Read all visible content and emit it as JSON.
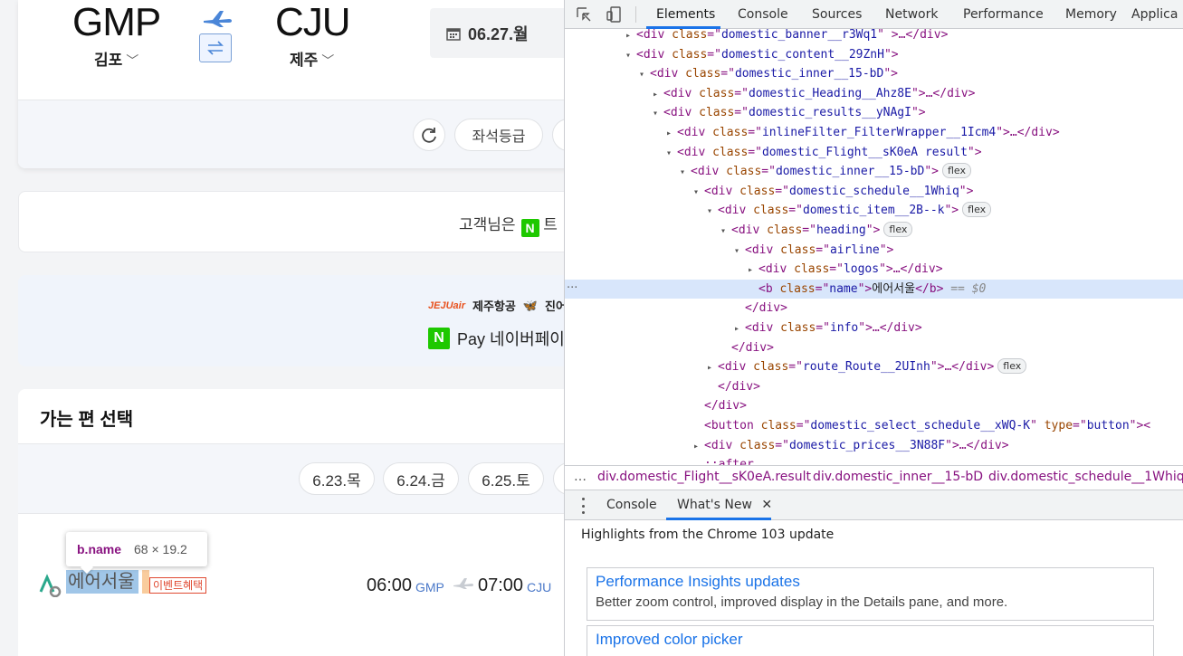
{
  "search": {
    "origin_code": "GMP",
    "origin_name": "김포",
    "dest_code": "CJU",
    "dest_name": "제주",
    "date": "06.27.월",
    "seat_filter": "좌석등급"
  },
  "notice": {
    "text": "고객님은",
    "badge": "N",
    "tail": "트"
  },
  "promo": {
    "airline_logo": "JEJUair",
    "airline_name": "제주항공",
    "airline2": "진어",
    "pay_badge": "N",
    "pay_text": "Pay 네이버페이포"
  },
  "results": {
    "title": "가는 편 선택",
    "dates": [
      "6.23.목",
      "6.24.금",
      "6.25.토"
    ]
  },
  "tooltip": {
    "selector": "b.name",
    "size": "68 × 19.2"
  },
  "flight": {
    "airline": "에어서울",
    "badge": "이벤트혜택",
    "dep_time": "06:00",
    "dep_code": "GMP",
    "arr_time": "07:00",
    "arr_code": "CJU"
  },
  "devtools": {
    "tabs": [
      "Elements",
      "Console",
      "Sources",
      "Network",
      "Performance",
      "Memory",
      "Applica"
    ],
    "dom": [
      {
        "indent": 0,
        "tri": "▸",
        "cls": "domestic_banner__r3Wq1",
        "tail": " >…</div>"
      },
      {
        "indent": 0,
        "tri": "▾",
        "cls": "domestic_content__29ZnH",
        "tail": ">"
      },
      {
        "indent": 1,
        "tri": "▾",
        "cls": "domestic_inner__15-bD",
        "tail": ">"
      },
      {
        "indent": 2,
        "tri": "▸",
        "cls": "domestic_Heading__Ahz8E",
        "tail": ">…</div>"
      },
      {
        "indent": 2,
        "tri": "▾",
        "cls": "domestic_results__yNAgI",
        "tail": ">"
      },
      {
        "indent": 3,
        "tri": "▸",
        "cls": "inlineFilter_FilterWrapper__1Icm4",
        "tail": ">…</div>"
      },
      {
        "indent": 3,
        "tri": "▾",
        "cls": "domestic_Flight__sK0eA result",
        "tail": ">"
      },
      {
        "indent": 4,
        "tri": "▾",
        "cls": "domestic_inner__15-bD",
        "tail": ">",
        "flex": "flex"
      },
      {
        "indent": 5,
        "tri": "▾",
        "cls": "domestic_schedule__1Whiq",
        "tail": ">"
      },
      {
        "indent": 6,
        "tri": "▾",
        "cls": "domestic_item__2B--k",
        "tail": ">",
        "flex": "flex"
      },
      {
        "indent": 7,
        "tri": "▾",
        "cls": "heading",
        "tail": ">",
        "flex": "flex"
      },
      {
        "indent": 8,
        "tri": "▾",
        "cls": "airline",
        "tail": ">"
      },
      {
        "indent": 9,
        "tri": "▸",
        "cls": "logos",
        "tail": ">…</div>"
      }
    ],
    "selected_line": {
      "tag": "b",
      "cls": "name",
      "text": "에어서울",
      "eq": "== $0"
    },
    "dom_after": [
      {
        "indent": 8,
        "raw": "</div>"
      },
      {
        "indent": 8,
        "tri": "▸",
        "cls": "info",
        "tail": ">…</div>"
      },
      {
        "indent": 7,
        "raw": "</div>"
      },
      {
        "indent": 6,
        "tri": "▸",
        "cls": "route_Route__2UInh",
        "tail": ">…</div>",
        "flex": "flex"
      },
      {
        "indent": 6,
        "raw": "</div>"
      },
      {
        "indent": 5,
        "raw": "</div>"
      },
      {
        "indent": 5,
        "button": true,
        "cls": "domestic_select_schedule__xWQ-K",
        "type": "button"
      },
      {
        "indent": 5,
        "tri": "▸",
        "cls": "domestic_prices__3N88F",
        "tail": ">…</div>"
      },
      {
        "indent": 5,
        "raw": "::after"
      }
    ],
    "breadcrumbs": [
      "div.domestic_Flight__sK0eA.result",
      "div.domestic_inner__15-bD",
      "div.domestic_schedule__1Whiq"
    ],
    "drawer_tabs": [
      "Console",
      "What's New"
    ],
    "whats_new_heading": "Highlights from the Chrome 103 update",
    "news": [
      {
        "title": "Performance Insights updates",
        "desc": "Better zoom control, improved display in the Details pane, and more."
      },
      {
        "title": "Improved color picker",
        "desc": ""
      }
    ]
  },
  "colors": {
    "accent": "#1a73e8",
    "highlight_content": "#6fa8dc",
    "tag": "#881280",
    "attr_name": "#994500",
    "attr_value": "#1a1aa6"
  }
}
